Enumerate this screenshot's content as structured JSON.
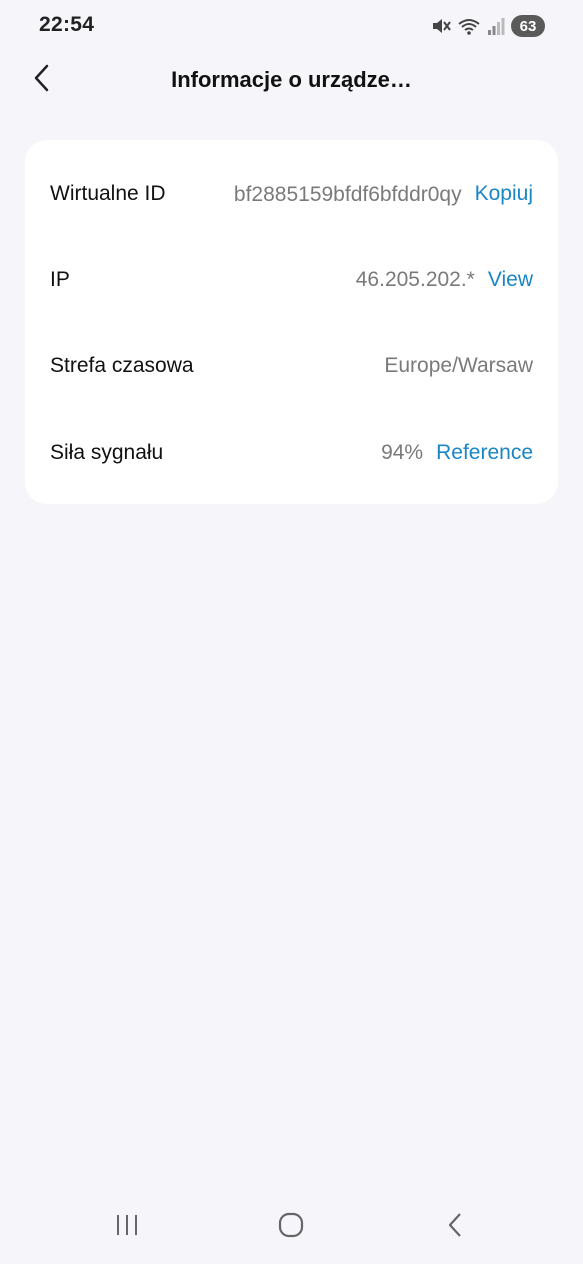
{
  "status_bar": {
    "time": "22:54",
    "battery": "63",
    "icons": [
      "mute-icon",
      "wifi-icon",
      "signal-icon",
      "battery-icon"
    ]
  },
  "header": {
    "title": "Informacje o urządze…",
    "back_icon": "chevron-left-icon"
  },
  "device_info": {
    "rows": [
      {
        "label": "Wirtualne ID",
        "value": "bf2885159bfdf6bfddr0qy",
        "action": "Kopiuj"
      },
      {
        "label": "IP",
        "value": "46.205.202.*",
        "action": "View"
      },
      {
        "label": "Strefa czasowa",
        "value": "Europe/Warsaw"
      },
      {
        "label": "Siła sygnału",
        "value": "94%",
        "action": "Reference"
      }
    ]
  },
  "nav_bar": {
    "icons": [
      "recent-apps-icon",
      "home-icon",
      "back-icon"
    ]
  },
  "colors": {
    "background": "#f6f6fa",
    "card": "#ffffff",
    "link": "#1a86c6",
    "value_text": "#7a7a7a"
  }
}
